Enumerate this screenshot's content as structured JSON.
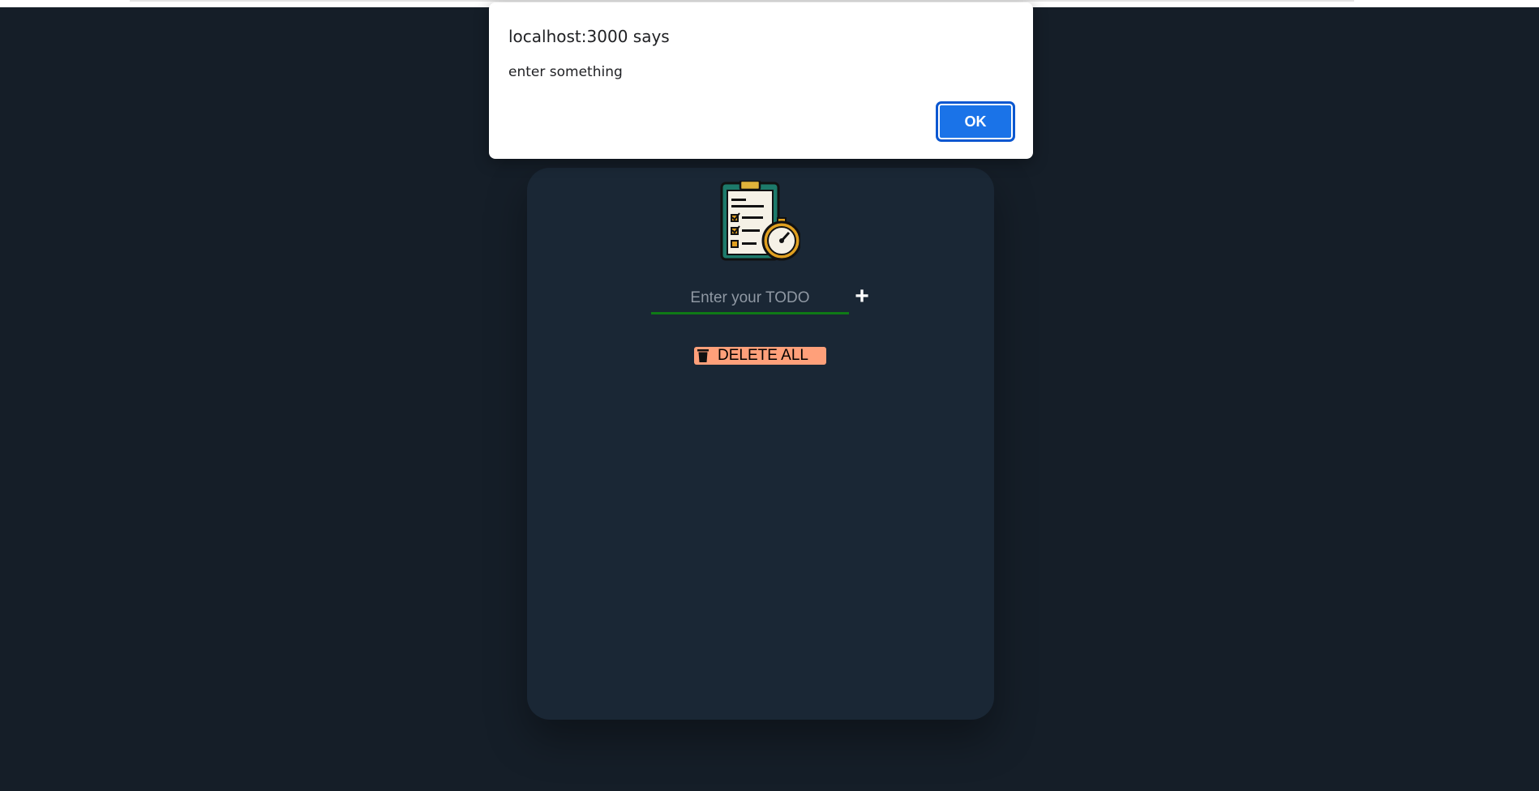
{
  "dialog": {
    "title": "localhost:3000 says",
    "message": "enter something",
    "ok_label": "OK"
  },
  "todo": {
    "input_placeholder": "Enter your TODO",
    "input_value": "",
    "add_label": "+",
    "delete_all_label": "DELETE ALL"
  },
  "icons": {
    "logo": "clipboard-stopwatch-icon",
    "add": "plus-icon",
    "delete": "trash-icon"
  },
  "colors": {
    "page_background": "#151e28",
    "card_background": "#1a2735",
    "input_underline": "#0f7a16",
    "delete_button": "#ffa07a",
    "ok_button": "#1a73e8"
  }
}
